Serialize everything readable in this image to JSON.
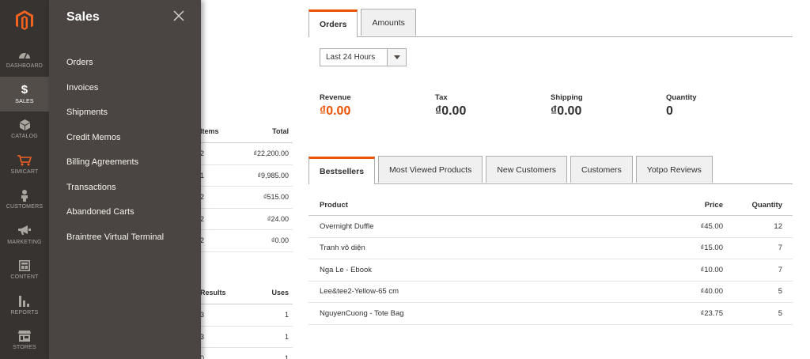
{
  "sidebar": {
    "items": [
      {
        "label": "DASHBOARD",
        "icon": "dashboard-icon"
      },
      {
        "label": "SALES",
        "icon": "dollar-icon",
        "symbol": "$"
      },
      {
        "label": "CATALOG",
        "icon": "cube-icon"
      },
      {
        "label": "SIMICART",
        "icon": "cart-icon"
      },
      {
        "label": "CUSTOMERS",
        "icon": "person-icon"
      },
      {
        "label": "MARKETING",
        "icon": "megaphone-icon"
      },
      {
        "label": "CONTENT",
        "icon": "layout-icon"
      },
      {
        "label": "REPORTS",
        "icon": "bar-chart-icon"
      },
      {
        "label": "STORES",
        "icon": "store-icon"
      }
    ]
  },
  "submenu": {
    "title": "Sales",
    "items": [
      "Orders",
      "Invoices",
      "Shipments",
      "Credit Memos",
      "Billing Agreements",
      "Transactions",
      "Abandoned Carts",
      "Braintree Virtual Terminal"
    ]
  },
  "left_tables": {
    "orders": {
      "headers": [
        "Items",
        "Total"
      ],
      "rows": [
        [
          "2",
          "₫22,200.00"
        ],
        [
          "1",
          "₫9,985.00"
        ],
        [
          "2",
          "₫515.00"
        ],
        [
          "2",
          "₫24.00"
        ],
        [
          "2",
          "₫0.00"
        ]
      ]
    },
    "search": {
      "headers": [
        "Results",
        "Uses"
      ],
      "rows": [
        [
          "3",
          "1"
        ],
        [
          "3",
          "1"
        ],
        [
          "0",
          "1"
        ]
      ]
    }
  },
  "chart_tabs": [
    "Orders",
    "Amounts"
  ],
  "period": {
    "selected": "Last 24 Hours"
  },
  "totals": [
    {
      "label": "Revenue",
      "value": "₫0.00"
    },
    {
      "label": "Tax",
      "value": "₫0.00"
    },
    {
      "label": "Shipping",
      "value": "₫0.00"
    },
    {
      "label": "Quantity",
      "value": "0"
    }
  ],
  "grid_tabs": [
    "Bestsellers",
    "Most Viewed Products",
    "New Customers",
    "Customers",
    "Yotpo Reviews"
  ],
  "bestsellers": {
    "headers": [
      "Product",
      "Price",
      "Quantity"
    ],
    "rows": [
      [
        "Overnight Duffle",
        "₫45.00",
        "12"
      ],
      [
        "Tranh vô diện",
        "₫15.00",
        "7"
      ],
      [
        "Nga Le - Ebook",
        "₫10.00",
        "7"
      ],
      [
        "Lee&tee2-Yellow-65 cm",
        "₫40.00",
        "5"
      ],
      [
        "NguyenCuong - Tote Bag",
        "₫23.75",
        "5"
      ]
    ]
  },
  "colors": {
    "accent": "#eb5202",
    "menu_bg": "#373330",
    "submenu_bg": "#4a4542"
  }
}
